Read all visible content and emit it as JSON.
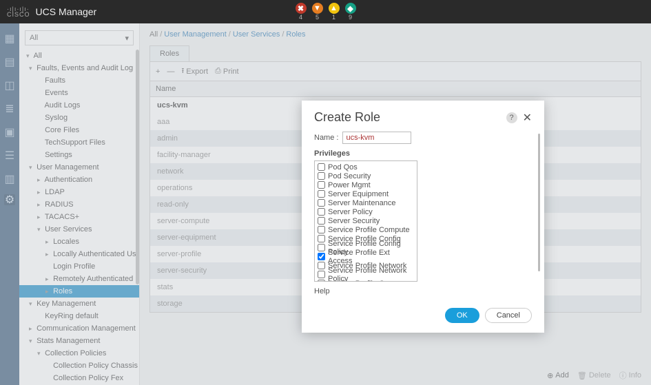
{
  "header": {
    "app_title": "UCS Manager",
    "logo_lines": "·|··|·\nCISCO"
  },
  "alerts": [
    {
      "count": "4",
      "glyph": "✖",
      "cls": "ac-red"
    },
    {
      "count": "5",
      "glyph": "▼",
      "cls": "ac-orange"
    },
    {
      "count": "1",
      "glyph": "▲",
      "cls": "ac-yellow"
    },
    {
      "count": "9",
      "glyph": "◆",
      "cls": "ac-teal"
    }
  ],
  "nav_filter": "All",
  "tree": [
    {
      "lvl": 0,
      "caret": "▾",
      "label": "All"
    },
    {
      "lvl": 1,
      "caret": "▾",
      "label": "Faults, Events and Audit Log"
    },
    {
      "lvl": 2,
      "caret": "",
      "label": "Faults"
    },
    {
      "lvl": 2,
      "caret": "",
      "label": "Events"
    },
    {
      "lvl": 2,
      "caret": "",
      "label": "Audit Logs"
    },
    {
      "lvl": 2,
      "caret": "",
      "label": "Syslog"
    },
    {
      "lvl": 2,
      "caret": "",
      "label": "Core Files"
    },
    {
      "lvl": 2,
      "caret": "",
      "label": "TechSupport Files"
    },
    {
      "lvl": 2,
      "caret": "",
      "label": "Settings"
    },
    {
      "lvl": 1,
      "caret": "▾",
      "label": "User Management"
    },
    {
      "lvl": 2,
      "caret": "▸",
      "label": "Authentication"
    },
    {
      "lvl": 2,
      "caret": "▸",
      "label": "LDAP"
    },
    {
      "lvl": 2,
      "caret": "▸",
      "label": "RADIUS"
    },
    {
      "lvl": 2,
      "caret": "▸",
      "label": "TACACS+"
    },
    {
      "lvl": 2,
      "caret": "▾",
      "label": "User Services"
    },
    {
      "lvl": 3,
      "caret": "▸",
      "label": "Locales"
    },
    {
      "lvl": 3,
      "caret": "▸",
      "label": "Locally Authenticated Users"
    },
    {
      "lvl": 3,
      "caret": "",
      "label": "Login Profile"
    },
    {
      "lvl": 3,
      "caret": "▸",
      "label": "Remotely Authenticated Users"
    },
    {
      "lvl": 3,
      "caret": "▸",
      "label": "Roles",
      "selected": true
    },
    {
      "lvl": 1,
      "caret": "▾",
      "label": "Key Management"
    },
    {
      "lvl": 2,
      "caret": "",
      "label": "KeyRing default"
    },
    {
      "lvl": 1,
      "caret": "▸",
      "label": "Communication Management"
    },
    {
      "lvl": 1,
      "caret": "▾",
      "label": "Stats Management"
    },
    {
      "lvl": 2,
      "caret": "▾",
      "label": "Collection Policies"
    },
    {
      "lvl": 3,
      "caret": "",
      "label": "Collection Policy Chassis"
    },
    {
      "lvl": 3,
      "caret": "",
      "label": "Collection Policy Fex"
    }
  ],
  "breadcrumb": [
    "All",
    "User Management",
    "User Services",
    "Roles"
  ],
  "tab_label": "Roles",
  "toolbar": {
    "plus": "+",
    "minus": "—",
    "export": "Export",
    "print": "Print"
  },
  "grid": {
    "header": "Name",
    "rows": [
      {
        "v": "ucs-kvm",
        "bold": true
      },
      {
        "v": "aaa"
      },
      {
        "v": "admin"
      },
      {
        "v": "facility-manager"
      },
      {
        "v": "network"
      },
      {
        "v": "operations"
      },
      {
        "v": "read-only"
      },
      {
        "v": "server-compute"
      },
      {
        "v": "server-equipment"
      },
      {
        "v": "server-profile"
      },
      {
        "v": "server-security"
      },
      {
        "v": "stats"
      },
      {
        "v": "storage"
      }
    ]
  },
  "footer": {
    "add": "Add",
    "delete": "Delete",
    "info": "Info"
  },
  "dialog": {
    "title": "Create Role",
    "name_label": "Name :",
    "name_value": "ucs-kvm",
    "privileges_label": "Privileges",
    "help_label": "Help",
    "ok": "OK",
    "cancel": "Cancel",
    "privileges": [
      {
        "label": "Pod Qos",
        "checked": false
      },
      {
        "label": "Pod Security",
        "checked": false
      },
      {
        "label": "Power Mgmt",
        "checked": false
      },
      {
        "label": "Server Equipment",
        "checked": false
      },
      {
        "label": "Server Maintenance",
        "checked": false
      },
      {
        "label": "Server Policy",
        "checked": false
      },
      {
        "label": "Server Security",
        "checked": false
      },
      {
        "label": "Service Profile Compute",
        "checked": false
      },
      {
        "label": "Service Profile Config",
        "checked": false
      },
      {
        "label": "Service Profile Config Policy",
        "checked": false
      },
      {
        "label": "Service Profile Ext Access",
        "checked": true
      },
      {
        "label": "Service Profile Network",
        "checked": false
      },
      {
        "label": "Service Profile Network Policy",
        "checked": false
      },
      {
        "label": "Service Profile Qos",
        "checked": false
      }
    ]
  }
}
